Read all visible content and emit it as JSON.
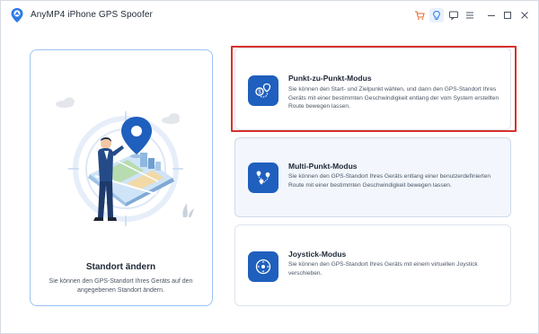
{
  "app": {
    "title": "AnyMP4 iPhone GPS Spoofer"
  },
  "titlebar_buttons": [
    {
      "icon": "cart-icon",
      "color": "#e96a2a"
    },
    {
      "icon": "bulb-icon",
      "color": "#2e7be6"
    },
    {
      "icon": "chat-icon",
      "color": "#4a5360"
    },
    {
      "icon": "menu-icon",
      "color": "#4a5360"
    },
    {
      "icon": "minimize-icon",
      "color": "#4a5360"
    },
    {
      "icon": "maximize-icon",
      "color": "#4a5360"
    },
    {
      "icon": "close-icon",
      "color": "#4a5360"
    }
  ],
  "left_card": {
    "title": "Standort ändern",
    "description": "Sie können den GPS-Standort Ihres Geräts auf den angegebenen Standort ändern."
  },
  "modes": [
    {
      "title": "Punkt-zu-Punkt-Modus",
      "description": "Sie können den Start- und Zielpunkt wählen, und dann den GPS-Standort Ihres Geräts mit einer bestimmten Geschwindigkeit entlang der vom System erstellten Route bewegen lassen.",
      "icon": "point-to-point-icon"
    },
    {
      "title": "Multi-Punkt-Modus",
      "description": "Sie können den GPS-Standort Ihres Geräts entlang einer benutzerdefinierten Route mit einer bestimmten Geschwindigkeit bewegen lassen.",
      "icon": "multi-point-icon"
    },
    {
      "title": "Joystick-Modus",
      "description": "Sie können den GPS-Standort Ihres Geräts mit einem virtuellen Joystick verschieben.",
      "icon": "joystick-icon"
    }
  ],
  "colors": {
    "accent": "#1f5fbd",
    "highlight": "#d9302c",
    "selected_card_bg": "#f3f7fd",
    "left_card_border": "#9bc3f5"
  }
}
